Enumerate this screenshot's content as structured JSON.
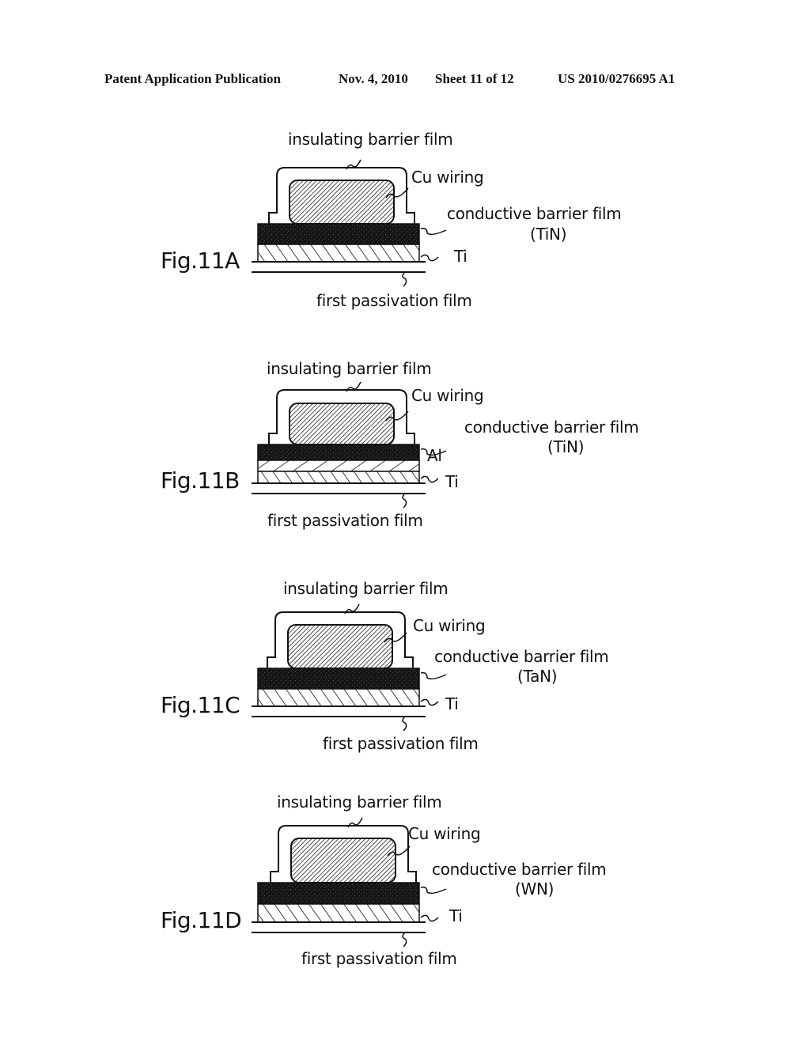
{
  "header": {
    "publication": "Patent Application Publication",
    "date": "Nov. 4, 2010",
    "sheet": "Sheet 11 of 12",
    "number": "US 2010/0276695 A1"
  },
  "figures": [
    {
      "id": "11A",
      "title": "Fig.11A",
      "insulating": "insulating barrier film",
      "cu": "Cu wiring",
      "conductive": "conductive barrier film",
      "material": "(TiN)",
      "ti": "Ti",
      "passivation": "first passivation film",
      "layers": [
        "Cu wiring",
        "conductive barrier film (TiN)",
        "Ti"
      ]
    },
    {
      "id": "11B",
      "title": "Fig.11B",
      "insulating": "insulating barrier film",
      "cu": "Cu wiring",
      "conductive": "conductive barrier film",
      "material": "(TiN)",
      "al": "Al",
      "ti": "Ti",
      "passivation": "first passivation film",
      "layers": [
        "Cu wiring",
        "conductive barrier film (TiN)",
        "Al",
        "Ti"
      ]
    },
    {
      "id": "11C",
      "title": "Fig.11C",
      "insulating": "insulating barrier film",
      "cu": "Cu wiring",
      "conductive": "conductive barrier film",
      "material": "(TaN)",
      "ti": "Ti",
      "passivation": "first passivation film",
      "layers": [
        "Cu wiring",
        "conductive barrier film (TaN)",
        "Ti"
      ]
    },
    {
      "id": "11D",
      "title": "Fig.11D",
      "insulating": "insulating barrier film",
      "cu": "Cu wiring",
      "conductive": "conductive barrier film",
      "material": "(WN)",
      "ti": "Ti",
      "passivation": "first passivation film",
      "layers": [
        "Cu wiring",
        "conductive barrier film (WN)",
        "Ti"
      ]
    }
  ]
}
